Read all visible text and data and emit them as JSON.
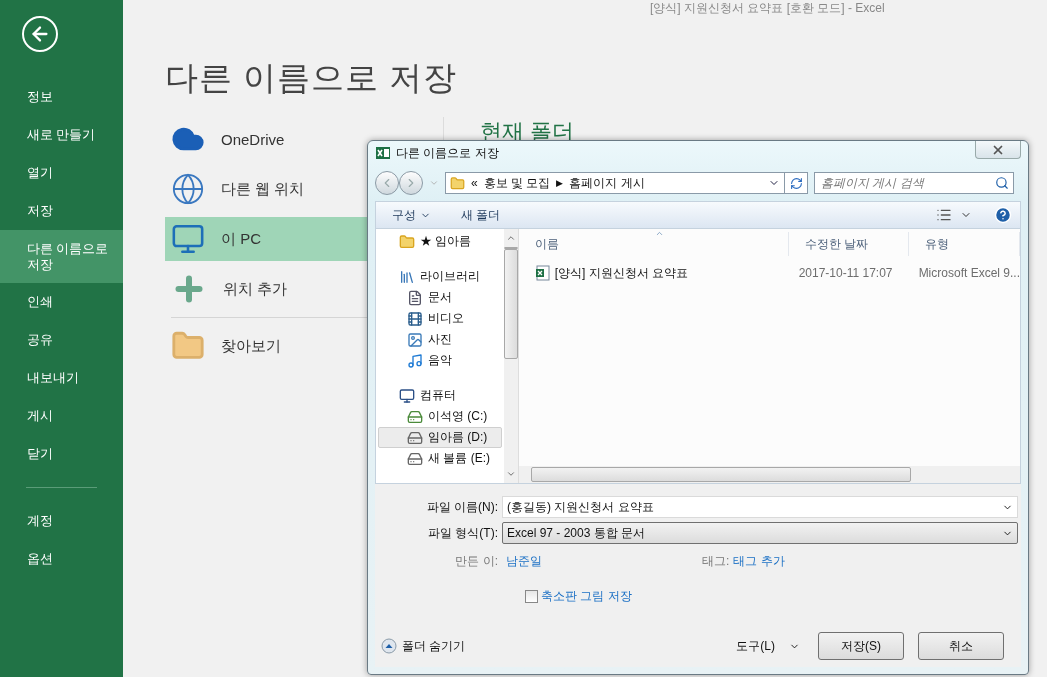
{
  "app_title": "[양식] 지원신청서 요약표  [호환 모드] - Excel",
  "sidebar": {
    "items": [
      {
        "label": "정보",
        "selected": false
      },
      {
        "label": "새로 만들기",
        "selected": false
      },
      {
        "label": "열기",
        "selected": false
      },
      {
        "label": "저장",
        "selected": false
      },
      {
        "label": "다른 이름으로 저장",
        "selected": true
      },
      {
        "label": "인쇄",
        "selected": false
      },
      {
        "label": "공유",
        "selected": false
      },
      {
        "label": "내보내기",
        "selected": false
      },
      {
        "label": "게시",
        "selected": false
      },
      {
        "label": "닫기",
        "selected": false
      }
    ],
    "footer_items": [
      {
        "label": "계정",
        "selected": false
      },
      {
        "label": "옵션",
        "selected": false
      }
    ]
  },
  "heading": "다른 이름으로 저장",
  "locations": [
    {
      "kind": "cloud",
      "label": "OneDrive",
      "selected": false
    },
    {
      "kind": "web",
      "label": "다른 웹 위치",
      "selected": false
    },
    {
      "kind": "pc",
      "label": "이 PC",
      "selected": true
    },
    {
      "kind": "add",
      "label": "위치 추가",
      "selected": false
    },
    {
      "kind": "browse",
      "label": "찾아보기",
      "selected": false
    }
  ],
  "current_folder_heading": "현재 폴더",
  "dialog": {
    "title": "다른 이름으로 저장",
    "address": {
      "prefix": "«",
      "separator": "▶",
      "path": [
        "홍보 및 모집",
        "홈페이지 게시"
      ]
    },
    "search": {
      "placeholder": "홈페이지 게시 검색"
    },
    "toolbar": [
      "구성",
      "새 폴더"
    ],
    "nav": [
      {
        "kind": "folder",
        "label": "★ 임아름",
        "selected": false
      },
      {
        "kind": "library",
        "label": "라이브러리",
        "selected": false,
        "children": [
          {
            "kind": "document",
            "label": "문서",
            "selected": false
          },
          {
            "kind": "video",
            "label": "비디오",
            "selected": false
          },
          {
            "kind": "picture",
            "label": "사진",
            "selected": false
          },
          {
            "kind": "music",
            "label": "음악",
            "selected": false
          }
        ]
      },
      {
        "kind": "computer",
        "label": "컴퓨터",
        "selected": false,
        "children": [
          {
            "kind": "system_drive",
            "label": "이석영 (C:)",
            "selected": false
          },
          {
            "kind": "drive",
            "label": "임아름 (D:)",
            "selected": true
          },
          {
            "kind": "drive",
            "label": "새 볼륨 (E:)",
            "selected": false
          }
        ]
      }
    ],
    "columns": [
      "이름",
      "수정한 날짜",
      "유형"
    ],
    "rows": [
      {
        "name": "[양식] 지원신청서 요약표",
        "date": "2017-10-11 17:07",
        "type": "Microsoft Excel 9..."
      }
    ],
    "file_name": {
      "label": "파일 이름(N):",
      "value": "(홍길동) 지원신청서 요약표"
    },
    "file_type": {
      "label": "파일 형식(T):",
      "value": "Excel 97 - 2003 통합 문서"
    },
    "author": {
      "label": "만든 이:",
      "value": "남준일"
    },
    "tags": {
      "label": "태그:",
      "value": "태그 추가"
    },
    "thumbnail": {
      "label": "축소판 그림 저장",
      "checked": false
    },
    "hide_folders": "폴더 숨기기",
    "tools": "도구(L)",
    "buttons": [
      "저장(S)",
      "취소"
    ]
  }
}
